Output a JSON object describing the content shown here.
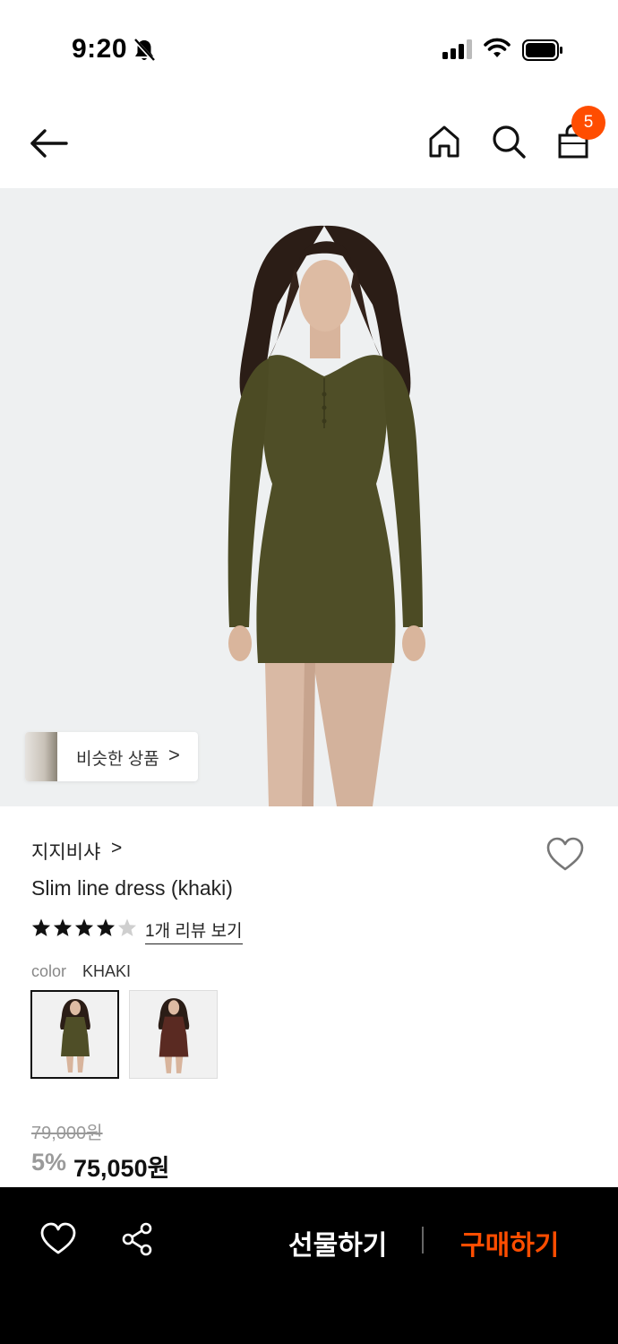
{
  "status_bar": {
    "time": "9:20"
  },
  "nav": {
    "cart_count": "5"
  },
  "hero": {
    "similar_label": "비슷한 상품",
    "similar_chevron": ">"
  },
  "product": {
    "brand": "지지비샤",
    "brand_chevron": ">",
    "title": "Slim line dress (khaki)",
    "rating": 4,
    "rating_max": 5,
    "review_link": "1개 리뷰 보기",
    "color_label": "color",
    "color_value": "KHAKI",
    "swatches": [
      {
        "name": "khaki",
        "color": "#4f4e27",
        "selected": true
      },
      {
        "name": "brown",
        "color": "#5a2a22",
        "selected": false
      }
    ],
    "original_price": "79,000원",
    "discount": "5%",
    "sale_price": "75,050원"
  },
  "bottom_bar": {
    "gift_label": "선물하기",
    "buy_label": "구매하기"
  },
  "colors": {
    "accent": "#ff4d00",
    "bar": "#000000",
    "hero_bg": "#eef0f1",
    "dress": "#4f4e27"
  }
}
